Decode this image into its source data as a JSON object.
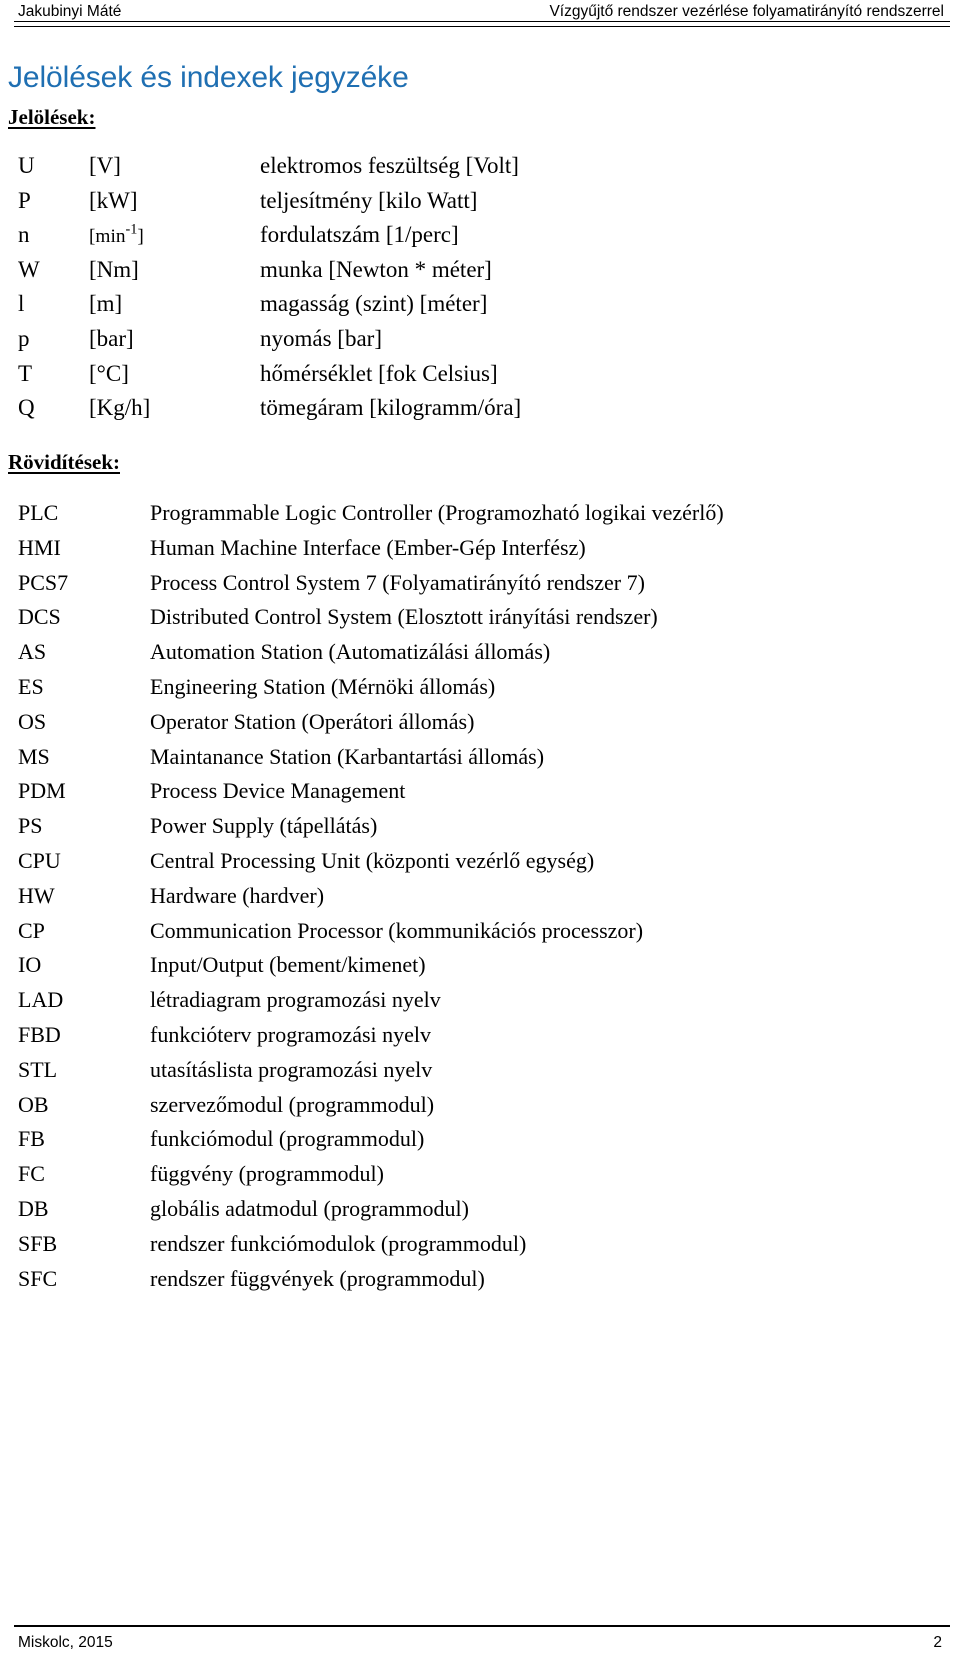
{
  "header": {
    "author": "Jakubinyi Máté",
    "document_title": "Vízgyűjtő rendszer vezérlése folyamatirányító rendszerrel"
  },
  "title": "Jelölések és indexek jegyzéke",
  "sections": {
    "symbols_heading": "Jelölések:",
    "abbreviations_heading": "Rövidítések:"
  },
  "symbols": [
    {
      "symbol": "U",
      "unit": "[V]",
      "description": "elektromos feszültség [Volt]"
    },
    {
      "symbol": "P",
      "unit": "[kW]",
      "description": "teljesítmény [kilo Watt]"
    },
    {
      "symbol": "n",
      "unit": "[min-1]",
      "unit_base": "[min",
      "unit_sup": "-1",
      "unit_tail": "]",
      "description": "fordulatszám [1/perc]"
    },
    {
      "symbol": "W",
      "unit": "[Nm]",
      "description": "munka [Newton * méter]"
    },
    {
      "symbol": "l",
      "unit": "[m]",
      "description": "magasság (szint) [méter]"
    },
    {
      "symbol": "p",
      "unit": "[bar]",
      "description": "nyomás [bar]"
    },
    {
      "symbol": "T",
      "unit": "[°C]",
      "description": "hőmérséklet [fok Celsius]"
    },
    {
      "symbol": "Q",
      "unit": "[Kg/h]",
      "description": "tömegáram  [kilogramm/óra]"
    }
  ],
  "abbreviations": [
    {
      "abbr": "PLC",
      "meaning": "Programmable Logic Controller (Programozható logikai vezérlő)"
    },
    {
      "abbr": "HMI",
      "meaning": "Human Machine Interface (Ember-Gép Interfész)"
    },
    {
      "abbr": "PCS7",
      "meaning": "Process Control System 7 (Folyamatirányító rendszer 7)"
    },
    {
      "abbr": "DCS",
      "meaning": "Distributed Control System (Elosztott irányítási rendszer)"
    },
    {
      "abbr": "AS",
      "meaning": "Automation Station (Automatizálási állomás)"
    },
    {
      "abbr": "ES",
      "meaning": "Engineering Station (Mérnöki állomás)"
    },
    {
      "abbr": "OS",
      "meaning": "Operator Station (Operátori állomás)"
    },
    {
      "abbr": "MS",
      "meaning": "Maintanance Station (Karbantartási állomás)"
    },
    {
      "abbr": "PDM",
      "meaning": "Process Device Management"
    },
    {
      "abbr": "PS",
      "meaning": "Power Supply (tápellátás)"
    },
    {
      "abbr": "CPU",
      "meaning": "Central Processing Unit (központi vezérlő egység)"
    },
    {
      "abbr": "HW",
      "meaning": "Hardware (hardver)"
    },
    {
      "abbr": "CP",
      "meaning": "Communication Processor (kommunikációs processzor)"
    },
    {
      "abbr": "IO",
      "meaning": "Input/Output (bement/kimenet)"
    },
    {
      "abbr": "LAD",
      "meaning": "létradiagram programozási nyelv"
    },
    {
      "abbr": "FBD",
      "meaning": "funkcióterv programozási nyelv"
    },
    {
      "abbr": "STL",
      "meaning": "utasításlista programozási nyelv"
    },
    {
      "abbr": "OB",
      "meaning": "szervezőmodul (programmodul)"
    },
    {
      "abbr": "FB",
      "meaning": "funkciómodul (programmodul)"
    },
    {
      "abbr": "FC",
      "meaning": "függvény (programmodul)"
    },
    {
      "abbr": "DB",
      "meaning": "globális adatmodul (programmodul)"
    },
    {
      "abbr": "SFB",
      "meaning": "rendszer funkciómodulok (programmodul)"
    },
    {
      "abbr": "SFC",
      "meaning": "rendszer függvények (programmodul)"
    }
  ],
  "footer": {
    "place_year": "Miskolc, 2015",
    "page_number": "2"
  },
  "colors": {
    "title_blue": "#1F6FB2",
    "text_black": "#000000",
    "page_background": "#FFFFFF"
  }
}
